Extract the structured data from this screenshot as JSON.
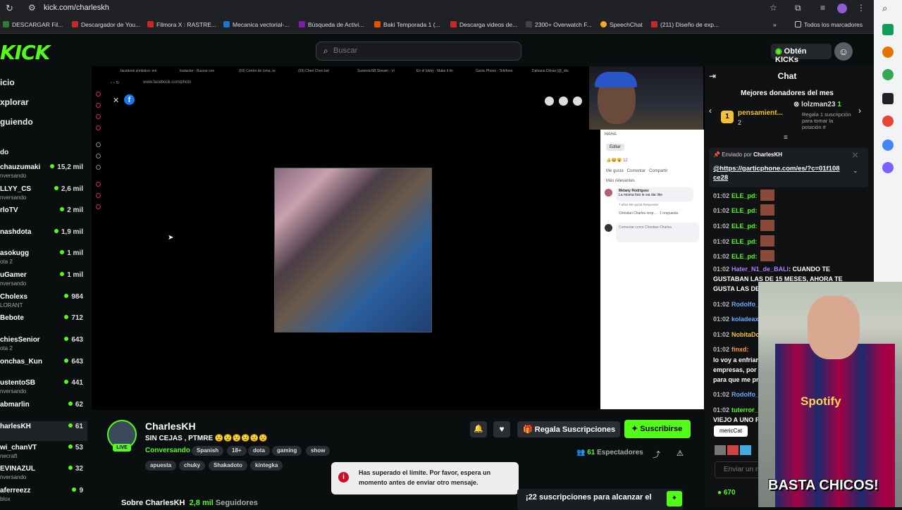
{
  "browser": {
    "url": "kick.com/charleskh",
    "bookmarks": [
      {
        "label": "DESCARGAR Fil...",
        "color": "#2e7d32"
      },
      {
        "label": "Descargador de You...",
        "color": "#c62828"
      },
      {
        "label": "Filmora X : RASTRE...",
        "color": "#c62828"
      },
      {
        "label": "Mecanica vectorial-...",
        "color": "#1976d2"
      },
      {
        "label": "Búsqueda de Activi...",
        "color": "#7b1fa2"
      },
      {
        "label": "Baki Temporada 1 (...",
        "color": "#e65100"
      },
      {
        "label": "Descarga videos de...",
        "color": "#c62828"
      },
      {
        "label": "2300+ Overwatch F...",
        "color": "#424242"
      },
      {
        "label": "SpeechChat",
        "color": "#f9a825"
      },
      {
        "label": "(211) Diseño de exp...",
        "color": "#c62828"
      }
    ],
    "all_bookmarks": "Todos los marcadores"
  },
  "header": {
    "logo": "KICK",
    "search_placeholder": "Buscar",
    "kicks_label": "Obtén KICKs"
  },
  "nav": {
    "links": [
      "icio",
      "xplorar",
      "guiendo"
    ],
    "section": "do"
  },
  "channels": [
    {
      "name": "chauzumaki",
      "sub": "nversando",
      "viewers": "15,2 mil"
    },
    {
      "name": "LLYY_CS",
      "sub": "nversando",
      "viewers": "2,6 mil"
    },
    {
      "name": "rloTV",
      "sub": "",
      "viewers": "2 mil"
    },
    {
      "name": "nashdota",
      "sub": "",
      "viewers": "1,9 mil"
    },
    {
      "name": "asokugg",
      "sub": "ota 2",
      "viewers": "1 mil"
    },
    {
      "name": "uGamer",
      "sub": "nversando",
      "viewers": "1 mil"
    },
    {
      "name": "Cholexs",
      "sub": "LORANT",
      "viewers": "984"
    },
    {
      "name": "Bebote",
      "sub": "",
      "viewers": "712"
    },
    {
      "name": "chiesSenior",
      "sub": "ota 2",
      "viewers": "643"
    },
    {
      "name": "onchas_Kun",
      "sub": "",
      "viewers": "643"
    },
    {
      "name": "ustentoSB",
      "sub": "nversando",
      "viewers": "441"
    },
    {
      "name": "abmarlin",
      "sub": "",
      "viewers": "62"
    },
    {
      "name": "harlesKH",
      "sub": "",
      "viewers": "61"
    },
    {
      "name": "wi_chanVT",
      "sub": "necraft",
      "viewers": "53"
    },
    {
      "name": "EVINAZUL",
      "sub": "nversando",
      "viewers": "32"
    },
    {
      "name": "aferreezz",
      "sub": "blox",
      "viewers": "9"
    }
  ],
  "video": {
    "screen_tabs": [
      "facebook símbolos: em",
      "traductor - Buscar con",
      "(59) Centro de Lima, re",
      "(59) Cheri Cheri lad",
      "SustentoSB Stream - Vi",
      "En el lobby - Make it lin",
      "Gartic Phone - Teléfono",
      "Dahiana Dilosa (@_dio"
    ],
    "fb_url": "www.facebook.com/photo",
    "fb_panel": {
      "haha": "HAHA",
      "edit": "Editar",
      "reactions": "12",
      "actions": [
        "Me gusta",
        "Comentar",
        "Compartir"
      ],
      "relevant": "Más relevantes",
      "commenter": "Melany Rodriguez",
      "comment": "La misma foto le wa dar like",
      "meta": "7 años   Me gusta   Responder",
      "reply": "Christian Charles resp... · 1 respuesta",
      "compose": "Comentar como Christian Charles"
    }
  },
  "stream": {
    "name": "CharlesKH",
    "title": "SIN CEJAS , PTMRE 😟😟😟😟😟😟",
    "category": "Conversando",
    "tags_row1": [
      "Spanish",
      "18+",
      "dota",
      "gaming",
      "show"
    ],
    "tags_row2": [
      "apuesta",
      "chuky",
      "Shakadoto",
      "kintegka"
    ],
    "live": "LIVE",
    "gift_label": "Regala Suscripciones",
    "subscribe_label": "Suscribirse",
    "viewers_count": "61",
    "viewers_label": "Espectadores",
    "about_label": "Sobre CharlesKH",
    "followers_count": "2,8 mil",
    "followers_label": "Seguidores",
    "goal_text": "¡22 suscripciones para alcanzar el"
  },
  "toast": {
    "line1": "Has superado el límite. Por favor, espera un",
    "line2": "momento antes de enviar otro mensaje."
  },
  "chat": {
    "title": "Chat",
    "donors_title": "Mejores donadores del mes",
    "donor1": "pensamient...",
    "donor1_rank": "1",
    "donor1_count": "2",
    "donor2": "lolzman23",
    "donor2_count": "1",
    "donor3_text": "Regala 1 suscripción para tomar la posición #",
    "pinned_by_label": "Enviado por",
    "pinned_by": "CharlesKH",
    "pinned_link": "@https://garticphone.com/es/?c=01f108ce28",
    "messages": [
      {
        "time": "01:02",
        "user": "ELE_pd:",
        "text": ""
      },
      {
        "time": "01:02",
        "user": "ELE_pd:",
        "text": ""
      },
      {
        "time": "01:02",
        "user": "ELE_pd:",
        "text": ""
      },
      {
        "time": "01:02",
        "user": "ELE_pd:",
        "text": ""
      },
      {
        "time": "01:02",
        "user": "ELE_pd:",
        "text": ""
      }
    ],
    "hater_time": "01:02",
    "hater_user": "Hater_N1_de_BALI",
    "hater_text1": ": CUANDO TE",
    "hater_text2": "GUSTABAN LAS DE 15 MESES, AHORA TE",
    "hater_text3": "GUSTA LAS DE",
    "short_msgs": [
      {
        "time": "01:02",
        "user": "Rodolfo_"
      },
      {
        "time": "01:02",
        "user": "koladeax"
      },
      {
        "time": "01:02",
        "user": "NobitaDo"
      },
      {
        "time": "01:02",
        "user": "finxd:"
      }
    ],
    "finxd_text1": "lo voy a enfriar",
    "finxd_text2": "empresas, por",
    "finxd_text3": "para que me pr",
    "rodolfo2_time": "01:02",
    "rodolfo2_user": "Rodolfo_",
    "tuterror_time": "01:02",
    "tuterror_user": "tuterror_v",
    "viejo_text": "VIEJO A UNO F",
    "tooltip": "mericCat",
    "input_placeholder": "Enviar un m",
    "points": "670"
  },
  "overlay": {
    "brand": "Spotify",
    "caption": "BASTA CHICOS!"
  }
}
